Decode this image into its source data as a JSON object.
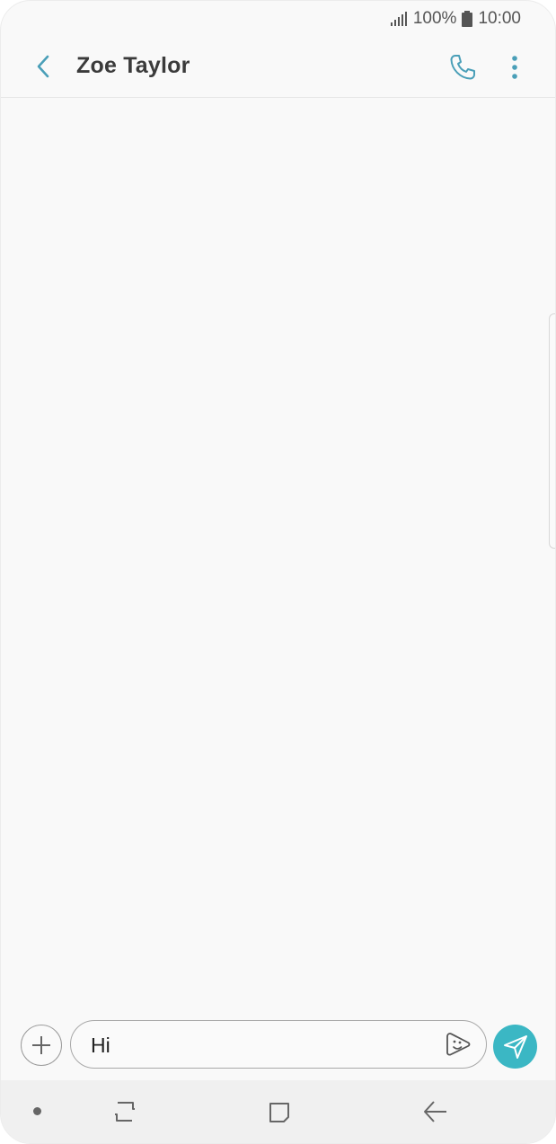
{
  "status_bar": {
    "battery": "100%",
    "time": "10:00",
    "icons": [
      "signal-icon",
      "battery-icon"
    ]
  },
  "header": {
    "title": "Zoe Taylor",
    "back_icon": "back-arrow-icon",
    "call_icon": "phone-icon",
    "more_icon": "more-vertical-icon",
    "accent_color": "#4a9fb8"
  },
  "compose": {
    "message_value": "Hi",
    "attach_icon": "plus-icon",
    "sticker_icon": "sticker-icon",
    "send_icon": "send-icon",
    "send_color": "#3bb7c4"
  },
  "navbar": {
    "icons": [
      "nav-dot-icon",
      "recent-apps-icon",
      "home-icon",
      "back-icon"
    ]
  }
}
